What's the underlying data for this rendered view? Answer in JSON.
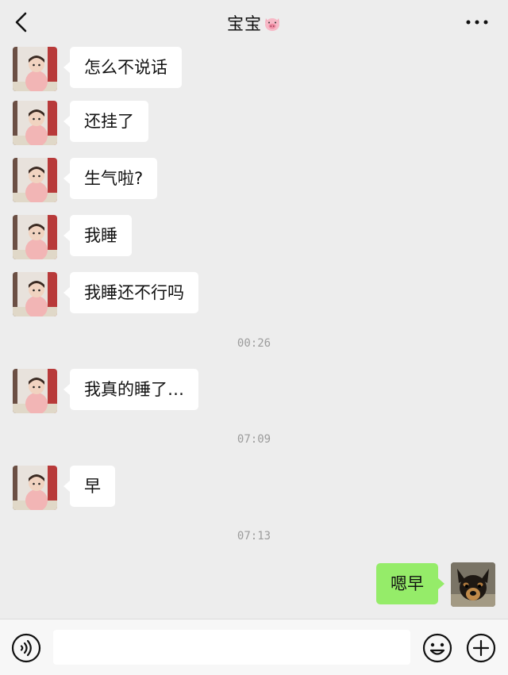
{
  "header": {
    "title": "宝宝",
    "title_emoji": "pig-face-icon",
    "back_icon": "chevron-left-icon",
    "more_icon": "more-dots-icon"
  },
  "messages": [
    {
      "from": "contact",
      "text": "怎么不说话"
    },
    {
      "from": "contact",
      "text": "还挂了"
    },
    {
      "from": "contact",
      "text": "生气啦?"
    },
    {
      "from": "contact",
      "text": "我睡"
    },
    {
      "from": "contact",
      "text": "我睡还不行吗"
    },
    {
      "time": "00:26"
    },
    {
      "from": "contact",
      "text": "我真的睡了…"
    },
    {
      "time": "07:09"
    },
    {
      "from": "contact",
      "text": "早"
    },
    {
      "time": "07:13"
    },
    {
      "from": "me",
      "text": "嗯早"
    }
  ],
  "input_bar": {
    "voice_icon": "voice-icon",
    "input_value": "",
    "emoji_icon": "emoji-icon",
    "plus_icon": "plus-icon"
  },
  "colors": {
    "background": "#ededed",
    "incoming_bubble": "#ffffff",
    "outgoing_bubble": "#95ec69",
    "timestamp": "#9c9c9c"
  }
}
